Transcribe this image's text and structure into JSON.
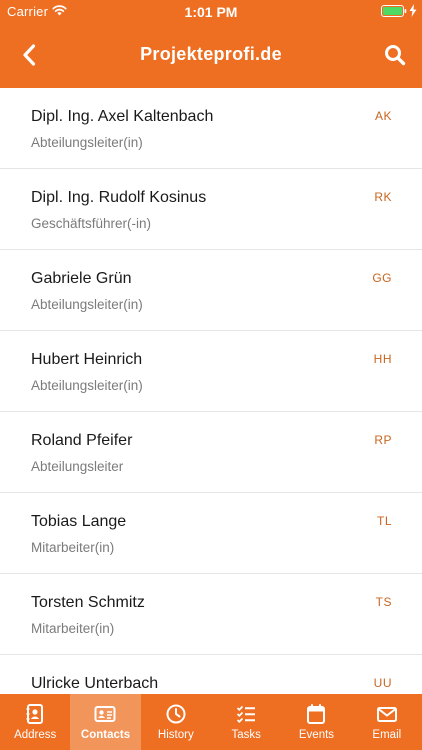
{
  "status_bar": {
    "carrier": "Carrier",
    "time": "1:01 PM"
  },
  "header": {
    "title": "Projekteprofi.de",
    "back_icon": "chevron-left-icon",
    "search_icon": "search-icon"
  },
  "contacts": [
    {
      "name": "Dipl. Ing. Axel Kaltenbach",
      "role": "Abteilungsleiter(in)",
      "initials": "AK"
    },
    {
      "name": "Dipl. Ing. Rudolf Kosinus",
      "role": "Geschäftsführer(-in)",
      "initials": "RK"
    },
    {
      "name": "Gabriele Grün",
      "role": "Abteilungsleiter(in)",
      "initials": "GG"
    },
    {
      "name": "Hubert Heinrich",
      "role": "Abteilungsleiter(in)",
      "initials": "HH"
    },
    {
      "name": "Roland Pfeifer",
      "role": "Abteilungsleiter",
      "initials": "RP"
    },
    {
      "name": "Tobias Lange",
      "role": "Mitarbeiter(in)",
      "initials": "TL"
    },
    {
      "name": "Torsten Schmitz",
      "role": "Mitarbeiter(in)",
      "initials": "TS"
    },
    {
      "name": "Ulricke Unterbach",
      "role": "",
      "initials": "UU"
    }
  ],
  "tabs": [
    {
      "label": "Address",
      "icon": "address-book-icon",
      "active": false
    },
    {
      "label": "Contacts",
      "icon": "contact-card-icon",
      "active": true
    },
    {
      "label": "History",
      "icon": "clock-icon",
      "active": false
    },
    {
      "label": "Tasks",
      "icon": "checklist-icon",
      "active": false
    },
    {
      "label": "Events",
      "icon": "calendar-icon",
      "active": false
    },
    {
      "label": "Email",
      "icon": "envelope-icon",
      "active": false
    }
  ],
  "colors": {
    "brand": "#ee6e22",
    "active_tab": "#f2955a",
    "initials": "#c8651f"
  }
}
